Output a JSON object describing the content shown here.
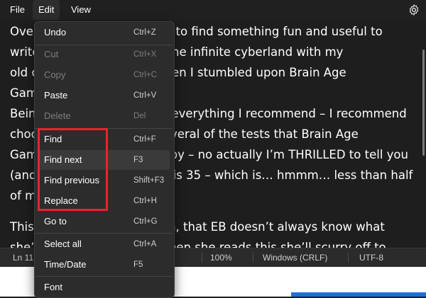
{
  "menubar": {
    "file": "File",
    "edit": "Edit",
    "view": "View",
    "settings_icon": "gear-icon"
  },
  "editor": {
    "lines": [
      "Over the weekend I needed to find something fun and useful to",
      "write about, so I went into the infinite cyberland with my",
      "old computer and that’s when I stumbled upon Brain Age",
      "Games.",
      "",
      "Being the person who tries everything I recommend – I recommend",
      "choosing this one. I took several of the tests that Brain Age",
      "Games offered and I’m happy – no actually I’m THRILLED to tell you",
      "(and I quote) that my brain is 35 –  which is… hmmm… less than half",
      "of my actual age.",
      "",
      "This leads me to the explain, that EB doesn’t always know what",
      "she’s saying. I know that when she reads this she’ll scurry off to"
    ]
  },
  "status": {
    "position": "Ln 11,",
    "zoom": "100%",
    "line_ending": "Windows (CRLF)",
    "encoding": "UTF-8"
  },
  "edit_menu": {
    "items": [
      {
        "label": "Undo",
        "shortcut": "Ctrl+Z"
      },
      {
        "label": "Cut",
        "shortcut": "Ctrl+X"
      },
      {
        "label": "Copy",
        "shortcut": "Ctrl+C"
      },
      {
        "label": "Paste",
        "shortcut": "Ctrl+V"
      },
      {
        "label": "Delete",
        "shortcut": "Del"
      },
      {
        "label": "Find",
        "shortcut": "Ctrl+F"
      },
      {
        "label": "Find next",
        "shortcut": "F3"
      },
      {
        "label": "Find previous",
        "shortcut": "Shift+F3"
      },
      {
        "label": "Replace",
        "shortcut": "Ctrl+H"
      },
      {
        "label": "Go to",
        "shortcut": "Ctrl+G"
      },
      {
        "label": "Select all",
        "shortcut": "Ctrl+A"
      },
      {
        "label": "Time/Date",
        "shortcut": "F5"
      },
      {
        "label": "Font",
        "shortcut": ""
      }
    ]
  },
  "colors": {
    "annotation_box": "#e8242b",
    "accent": "#1e6fd9"
  }
}
